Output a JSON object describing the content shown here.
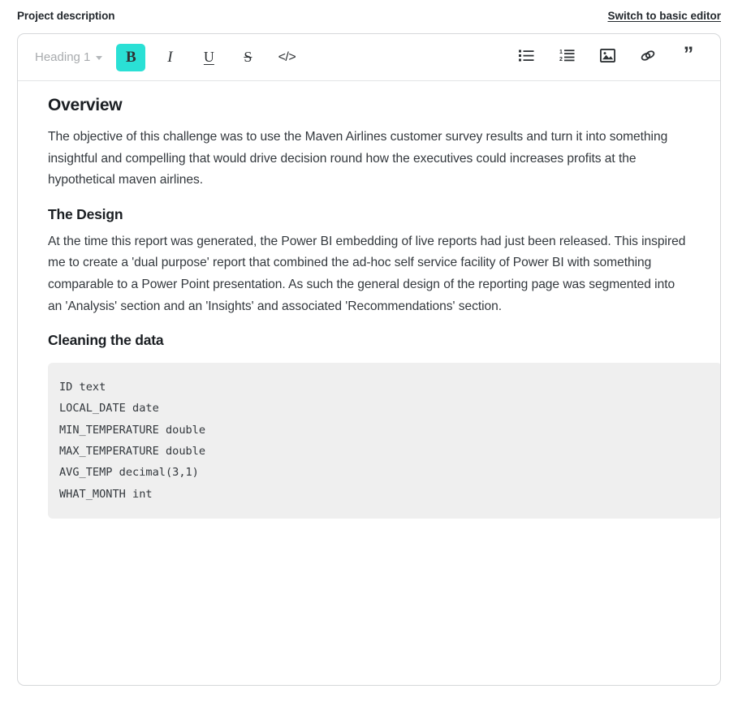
{
  "header": {
    "section_title": "Project description",
    "switch_link": "Switch to basic editor"
  },
  "toolbar": {
    "heading_select": {
      "value": "Heading 1",
      "caret_icon": "chevron-down-icon"
    },
    "buttons": [
      {
        "name": "bold",
        "icon": "bold-icon",
        "glyph": "B",
        "active": true
      },
      {
        "name": "italic",
        "icon": "italic-icon",
        "glyph": "I",
        "active": false
      },
      {
        "name": "underline",
        "icon": "underline-icon",
        "glyph": "U",
        "active": false
      },
      {
        "name": "strikethrough",
        "icon": "strikethrough-icon",
        "glyph": "S",
        "active": false
      },
      {
        "name": "code",
        "icon": "code-icon",
        "glyph": "</>",
        "active": false
      }
    ],
    "right_buttons": [
      {
        "name": "bullet-list",
        "icon": "bullet-list-icon"
      },
      {
        "name": "numbered-list",
        "icon": "numbered-list-icon"
      },
      {
        "name": "image",
        "icon": "image-icon"
      },
      {
        "name": "link",
        "icon": "link-icon"
      },
      {
        "name": "blockquote",
        "icon": "quote-icon",
        "glyph": "”"
      }
    ]
  },
  "document": {
    "overview_heading": "Overview",
    "overview_paragraph": "The objective of this challenge was to use the Maven Airlines customer survey results and turn it into something insightful and compelling that would drive decision round how the executives could increases profits at the hypothetical maven airlines.",
    "design_heading": "The Design",
    "design_paragraph": "At the time this report was generated, the Power BI embedding of live reports had just been released. This inspired me to create a 'dual purpose' report that combined the ad-hoc self service facility of Power BI with something comparable to a Power Point presentation. As such the general design of the reporting page was segmented into an 'Analysis' section and an 'Insights' and associated 'Recommendations' section.",
    "cleaning_heading": "Cleaning the data",
    "code_block": "ID text\nLOCAL_DATE date\nMIN_TEMPERATURE double\nMAX_TEMPERATURE double\nAVG_TEMP decimal(3,1)\nWHAT_MONTH int"
  },
  "colors": {
    "accent_teal": "#2AE0D5",
    "border_gray": "#D6D8DA",
    "code_bg": "#EFEFEF",
    "text_dark": "#33383D",
    "muted_gray": "#A8ABAE"
  }
}
